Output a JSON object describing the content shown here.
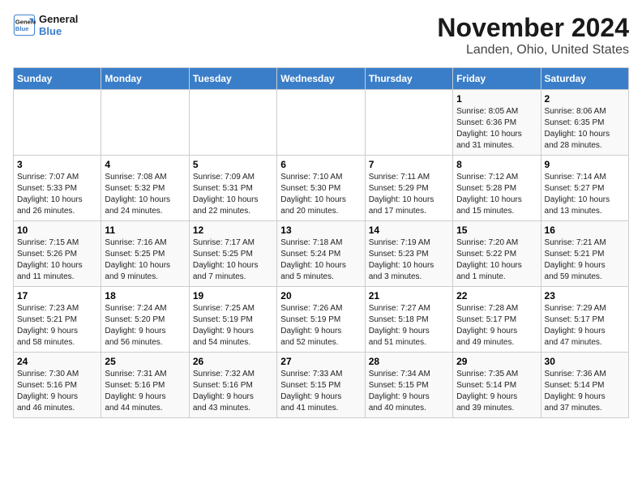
{
  "header": {
    "logo_line1": "General",
    "logo_line2": "Blue",
    "month": "November 2024",
    "location": "Landen, Ohio, United States"
  },
  "weekdays": [
    "Sunday",
    "Monday",
    "Tuesday",
    "Wednesday",
    "Thursday",
    "Friday",
    "Saturday"
  ],
  "weeks": [
    [
      {
        "day": "",
        "info": ""
      },
      {
        "day": "",
        "info": ""
      },
      {
        "day": "",
        "info": ""
      },
      {
        "day": "",
        "info": ""
      },
      {
        "day": "",
        "info": ""
      },
      {
        "day": "1",
        "info": "Sunrise: 8:05 AM\nSunset: 6:36 PM\nDaylight: 10 hours\nand 31 minutes."
      },
      {
        "day": "2",
        "info": "Sunrise: 8:06 AM\nSunset: 6:35 PM\nDaylight: 10 hours\nand 28 minutes."
      }
    ],
    [
      {
        "day": "3",
        "info": "Sunrise: 7:07 AM\nSunset: 5:33 PM\nDaylight: 10 hours\nand 26 minutes."
      },
      {
        "day": "4",
        "info": "Sunrise: 7:08 AM\nSunset: 5:32 PM\nDaylight: 10 hours\nand 24 minutes."
      },
      {
        "day": "5",
        "info": "Sunrise: 7:09 AM\nSunset: 5:31 PM\nDaylight: 10 hours\nand 22 minutes."
      },
      {
        "day": "6",
        "info": "Sunrise: 7:10 AM\nSunset: 5:30 PM\nDaylight: 10 hours\nand 20 minutes."
      },
      {
        "day": "7",
        "info": "Sunrise: 7:11 AM\nSunset: 5:29 PM\nDaylight: 10 hours\nand 17 minutes."
      },
      {
        "day": "8",
        "info": "Sunrise: 7:12 AM\nSunset: 5:28 PM\nDaylight: 10 hours\nand 15 minutes."
      },
      {
        "day": "9",
        "info": "Sunrise: 7:14 AM\nSunset: 5:27 PM\nDaylight: 10 hours\nand 13 minutes."
      }
    ],
    [
      {
        "day": "10",
        "info": "Sunrise: 7:15 AM\nSunset: 5:26 PM\nDaylight: 10 hours\nand 11 minutes."
      },
      {
        "day": "11",
        "info": "Sunrise: 7:16 AM\nSunset: 5:25 PM\nDaylight: 10 hours\nand 9 minutes."
      },
      {
        "day": "12",
        "info": "Sunrise: 7:17 AM\nSunset: 5:25 PM\nDaylight: 10 hours\nand 7 minutes."
      },
      {
        "day": "13",
        "info": "Sunrise: 7:18 AM\nSunset: 5:24 PM\nDaylight: 10 hours\nand 5 minutes."
      },
      {
        "day": "14",
        "info": "Sunrise: 7:19 AM\nSunset: 5:23 PM\nDaylight: 10 hours\nand 3 minutes."
      },
      {
        "day": "15",
        "info": "Sunrise: 7:20 AM\nSunset: 5:22 PM\nDaylight: 10 hours\nand 1 minute."
      },
      {
        "day": "16",
        "info": "Sunrise: 7:21 AM\nSunset: 5:21 PM\nDaylight: 9 hours\nand 59 minutes."
      }
    ],
    [
      {
        "day": "17",
        "info": "Sunrise: 7:23 AM\nSunset: 5:21 PM\nDaylight: 9 hours\nand 58 minutes."
      },
      {
        "day": "18",
        "info": "Sunrise: 7:24 AM\nSunset: 5:20 PM\nDaylight: 9 hours\nand 56 minutes."
      },
      {
        "day": "19",
        "info": "Sunrise: 7:25 AM\nSunset: 5:19 PM\nDaylight: 9 hours\nand 54 minutes."
      },
      {
        "day": "20",
        "info": "Sunrise: 7:26 AM\nSunset: 5:19 PM\nDaylight: 9 hours\nand 52 minutes."
      },
      {
        "day": "21",
        "info": "Sunrise: 7:27 AM\nSunset: 5:18 PM\nDaylight: 9 hours\nand 51 minutes."
      },
      {
        "day": "22",
        "info": "Sunrise: 7:28 AM\nSunset: 5:17 PM\nDaylight: 9 hours\nand 49 minutes."
      },
      {
        "day": "23",
        "info": "Sunrise: 7:29 AM\nSunset: 5:17 PM\nDaylight: 9 hours\nand 47 minutes."
      }
    ],
    [
      {
        "day": "24",
        "info": "Sunrise: 7:30 AM\nSunset: 5:16 PM\nDaylight: 9 hours\nand 46 minutes."
      },
      {
        "day": "25",
        "info": "Sunrise: 7:31 AM\nSunset: 5:16 PM\nDaylight: 9 hours\nand 44 minutes."
      },
      {
        "day": "26",
        "info": "Sunrise: 7:32 AM\nSunset: 5:16 PM\nDaylight: 9 hours\nand 43 minutes."
      },
      {
        "day": "27",
        "info": "Sunrise: 7:33 AM\nSunset: 5:15 PM\nDaylight: 9 hours\nand 41 minutes."
      },
      {
        "day": "28",
        "info": "Sunrise: 7:34 AM\nSunset: 5:15 PM\nDaylight: 9 hours\nand 40 minutes."
      },
      {
        "day": "29",
        "info": "Sunrise: 7:35 AM\nSunset: 5:14 PM\nDaylight: 9 hours\nand 39 minutes."
      },
      {
        "day": "30",
        "info": "Sunrise: 7:36 AM\nSunset: 5:14 PM\nDaylight: 9 hours\nand 37 minutes."
      }
    ]
  ]
}
